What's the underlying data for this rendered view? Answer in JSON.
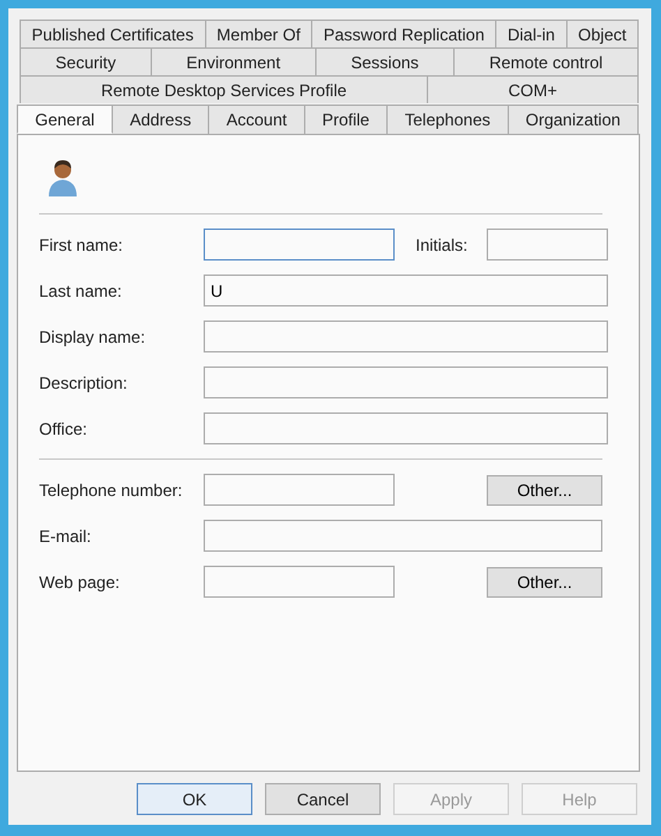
{
  "tab_rows": [
    [
      {
        "label": "Published Certificates",
        "selected": false
      },
      {
        "label": "Member Of",
        "selected": false
      },
      {
        "label": "Password Replication",
        "selected": false
      },
      {
        "label": "Dial-in",
        "selected": false
      },
      {
        "label": "Object",
        "selected": false
      }
    ],
    [
      {
        "label": "Security",
        "selected": false
      },
      {
        "label": "Environment",
        "selected": false
      },
      {
        "label": "Sessions",
        "selected": false
      },
      {
        "label": "Remote control",
        "selected": false
      }
    ],
    [
      {
        "label": "Remote Desktop Services Profile",
        "selected": false
      },
      {
        "label": "COM+",
        "selected": false
      }
    ],
    [
      {
        "label": "General",
        "selected": true
      },
      {
        "label": "Address",
        "selected": false
      },
      {
        "label": "Account",
        "selected": false
      },
      {
        "label": "Profile",
        "selected": false
      },
      {
        "label": "Telephones",
        "selected": false
      },
      {
        "label": "Organization",
        "selected": false
      }
    ]
  ],
  "sections": [
    {
      "fields": [
        {
          "kind": "pair",
          "label": "First name:",
          "focused": true,
          "second_label": "Initials:"
        },
        {
          "kind": "text",
          "label": "Last name:",
          "value": "U",
          "focused": false
        },
        {
          "kind": "text",
          "label": "Display name:",
          "focused": false
        },
        {
          "kind": "text",
          "label": "Description:",
          "focused": false
        },
        {
          "kind": "text",
          "label": "Office:",
          "focused": false
        }
      ]
    },
    {
      "fields": [
        {
          "kind": "button",
          "label": "Telephone number:",
          "focused": false,
          "button": "Other..."
        },
        {
          "kind": "text",
          "label": "E-mail:",
          "focused": false
        },
        {
          "kind": "button",
          "label": "Web page:",
          "focused": false,
          "button": "Other..."
        }
      ]
    }
  ],
  "buttons": [
    {
      "label": "OK",
      "default": true,
      "disabled": false
    },
    {
      "label": "Cancel",
      "default": false,
      "disabled": false
    },
    {
      "label": "Apply",
      "default": false,
      "disabled": true
    },
    {
      "label": "Help",
      "default": false,
      "disabled": true
    }
  ]
}
